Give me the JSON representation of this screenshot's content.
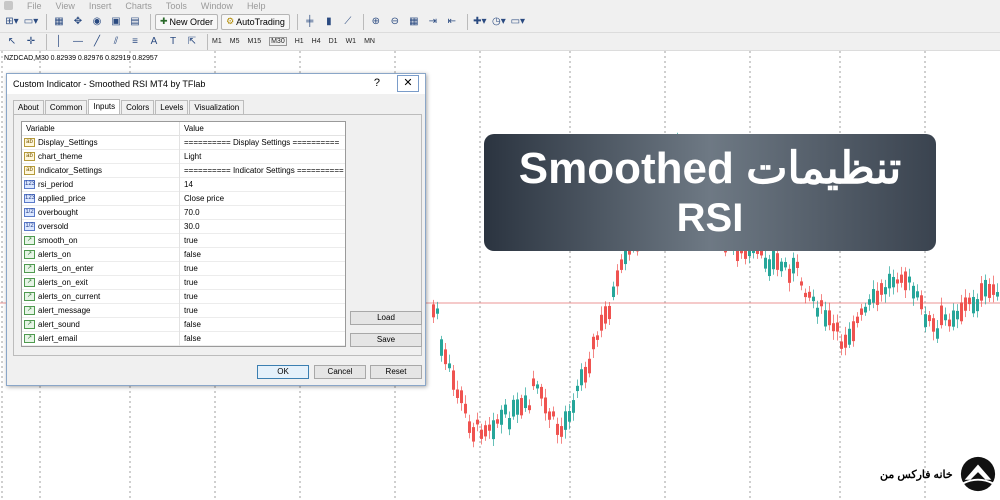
{
  "menubar": {
    "items": [
      "File",
      "View",
      "Insert",
      "Charts",
      "Tools",
      "Window",
      "Help"
    ]
  },
  "toolbar": {
    "new_order": "New Order",
    "autotrading": "AutoTrading"
  },
  "timeframes": [
    "M1",
    "M5",
    "M15",
    "M30",
    "H1",
    "H4",
    "D1",
    "W1",
    "MN"
  ],
  "chart": {
    "symbol_label": "NZDCAD,M30  0.82939 0.82976 0.82919 0.82957"
  },
  "dialog": {
    "title": "Custom Indicator - Smoothed RSI MT4 by TFlab",
    "help_glyph": "?",
    "close_glyph": "✕",
    "tabs": [
      "About",
      "Common",
      "Inputs",
      "Colors",
      "Levels",
      "Visualization"
    ],
    "active_tab": "Inputs",
    "col_variable": "Variable",
    "col_value": "Value",
    "rows": [
      {
        "icon": "ab",
        "name": "Display_Settings",
        "value": "========== Display Settings =========="
      },
      {
        "icon": "ab",
        "name": "chart_theme",
        "value": "Light"
      },
      {
        "icon": "ab",
        "name": "Indicator_Settings",
        "value": "========== Indicator Settings =========="
      },
      {
        "icon": "123",
        "name": "rsi_period",
        "value": "14"
      },
      {
        "icon": "123",
        "name": "applied_price",
        "value": "Close price"
      },
      {
        "icon": "1/2",
        "name": "overbought",
        "value": "70.0"
      },
      {
        "icon": "1/2",
        "name": "oversold",
        "value": "30.0"
      },
      {
        "icon": "bool",
        "name": "smooth_on",
        "value": "true"
      },
      {
        "icon": "bool",
        "name": "alerts_on",
        "value": "false"
      },
      {
        "icon": "bool",
        "name": "alerts_on_enter",
        "value": "true"
      },
      {
        "icon": "bool",
        "name": "alerts_on_exit",
        "value": "true"
      },
      {
        "icon": "bool",
        "name": "alerts_on_current",
        "value": "true"
      },
      {
        "icon": "bool",
        "name": "alert_message",
        "value": "true"
      },
      {
        "icon": "bool",
        "name": "alert_sound",
        "value": "false"
      },
      {
        "icon": "bool",
        "name": "alert_email",
        "value": "false"
      }
    ],
    "load_label": "Load",
    "save_label": "Save",
    "ok_label": "OK",
    "cancel_label": "Cancel",
    "reset_label": "Reset"
  },
  "overlay": {
    "line1": "تنظیمات Smoothed",
    "line2": "RSI"
  },
  "brand": {
    "text": "خانه فارکس من"
  },
  "colors": {
    "bull": "#26a69a",
    "bear": "#ef5350",
    "price_line": "#e57373",
    "grid": "#888888"
  }
}
